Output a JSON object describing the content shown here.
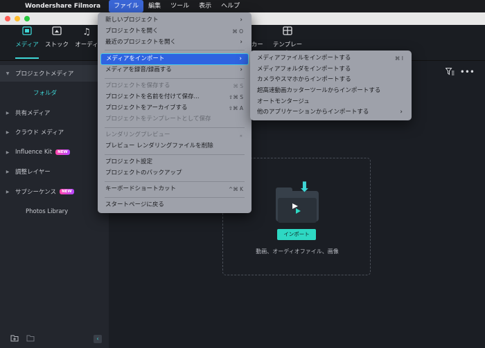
{
  "menubar": {
    "app_name": "Wondershare Filmora",
    "items": [
      "ファイル",
      "編集",
      "ツール",
      "表示",
      "ヘルプ"
    ]
  },
  "toolbar": {
    "buttons": [
      {
        "label": "メディア",
        "icon": "media-icon"
      },
      {
        "label": "ストック",
        "icon": "stock-icon"
      },
      {
        "label": "オーディ",
        "icon": "music-note-icon"
      },
      {
        "label": "ッカー",
        "icon": "sticker-icon"
      },
      {
        "label": "テンプレート",
        "icon": "template-icon"
      }
    ]
  },
  "sidebar": {
    "items": [
      {
        "label": "プロジェクトメディア"
      },
      {
        "label": "フォルダ"
      },
      {
        "label": "共有メディア"
      },
      {
        "label": "クラウド メディア"
      },
      {
        "label": "Influence Kit",
        "badge": "NEW"
      },
      {
        "label": "調整レイヤー"
      },
      {
        "label": "サブシーケンス",
        "badge": "NEW"
      },
      {
        "label": "Photos Library"
      }
    ]
  },
  "main": {
    "import_button": "インポート",
    "dropzone_hint": "動画、オーディオファイル、画像"
  },
  "file_menu": {
    "items": [
      {
        "label": "新しいプロジェクト",
        "shortcut": "",
        "submenu": true
      },
      {
        "label": "プロジェクトを開く",
        "shortcut": "⌘ O"
      },
      {
        "label": "最近のプロジェクトを開く",
        "shortcut": "",
        "submenu": true
      },
      {
        "label": "メディアをインポート",
        "shortcut": "",
        "submenu": true
      },
      {
        "label": "メディアを録音/録画する",
        "shortcut": "",
        "submenu": true
      },
      {
        "label": "プロジェクトを保存する",
        "shortcut": "⌘ S"
      },
      {
        "label": "プロジェクトを名前を付けて保存...",
        "shortcut": "⇧⌘ S"
      },
      {
        "label": "プロジェクトをアーカイブする",
        "shortcut": "⇧⌘ A"
      },
      {
        "label": "プロジェクトをテンプレートとして保存",
        "shortcut": ""
      },
      {
        "label": "レンダリングプレビュー",
        "shortcut": "⌅"
      },
      {
        "label": "プレビュー レンダリングファイルを削除",
        "shortcut": ""
      },
      {
        "label": "プロジェクト設定",
        "shortcut": ""
      },
      {
        "label": "プロジェクトのバックアップ",
        "shortcut": ""
      },
      {
        "label": "キーボードショートカット",
        "shortcut": "^⌘ K"
      },
      {
        "label": "スタートページに戻る",
        "shortcut": ""
      }
    ]
  },
  "import_submenu": {
    "items": [
      {
        "label": "メディアファイルをインポートする",
        "shortcut": "⌘ I"
      },
      {
        "label": "メディアフォルダをインポートする",
        "shortcut": ""
      },
      {
        "label": "カメラやスマホからインポートする",
        "shortcut": ""
      },
      {
        "label": "超高速動画カッターツールからインポートする",
        "shortcut": ""
      },
      {
        "label": "オートモンタージュ",
        "shortcut": ""
      },
      {
        "label": "他のアプリケーションからインポートする",
        "shortcut": "",
        "submenu": true
      }
    ]
  },
  "colors": {
    "accent": "#3ed6d6",
    "menu_highlight": "#2f63e0"
  }
}
